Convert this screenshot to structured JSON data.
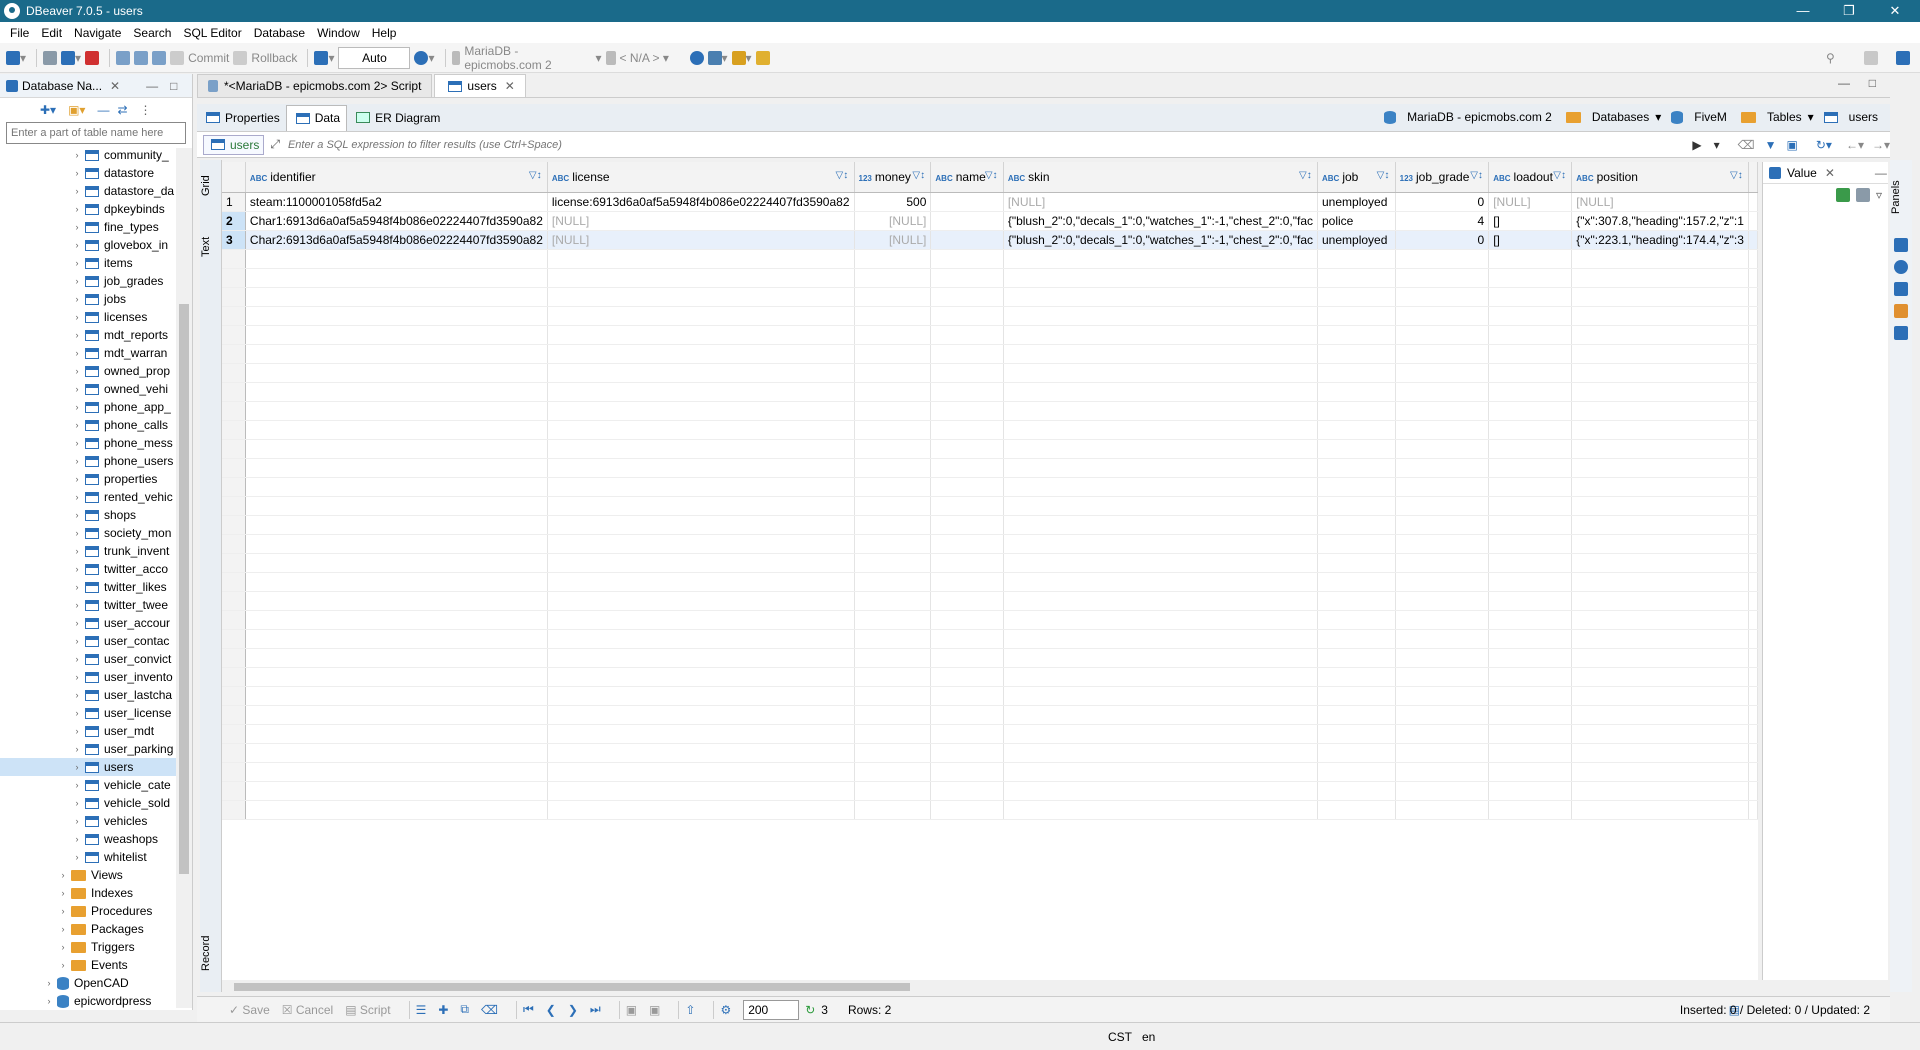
{
  "window": {
    "title": "DBeaver 7.0.5 - users"
  },
  "menu": [
    "File",
    "Edit",
    "Navigate",
    "Search",
    "SQL Editor",
    "Database",
    "Window",
    "Help"
  ],
  "toolbar": {
    "commit": "Commit",
    "rollback": "Rollback",
    "auto": "Auto",
    "connection": "MariaDB - epicmobs.com 2",
    "schema": "< N/A >"
  },
  "navigator": {
    "title": "Database Na...",
    "filter_placeholder": "Enter a part of table name here",
    "tables": [
      "community_",
      "datastore",
      "datastore_da",
      "dpkeybinds",
      "fine_types",
      "glovebox_in",
      "items",
      "job_grades",
      "jobs",
      "licenses",
      "mdt_reports",
      "mdt_warran",
      "owned_prop",
      "owned_vehi",
      "phone_app_",
      "phone_calls",
      "phone_mess",
      "phone_users",
      "properties",
      "rented_vehic",
      "shops",
      "society_mon",
      "trunk_invent",
      "twitter_acco",
      "twitter_likes",
      "twitter_twee",
      "user_accour",
      "user_contac",
      "user_convict",
      "user_invento",
      "user_lastcha",
      "user_license",
      "user_mdt",
      "user_parking",
      "users",
      "vehicle_cate",
      "vehicle_sold",
      "vehicles",
      "weashops",
      "whitelist"
    ],
    "selected": "users",
    "folders": [
      "Views",
      "Indexes",
      "Procedures",
      "Packages",
      "Triggers",
      "Events"
    ],
    "databases": [
      "OpenCAD",
      "epicwordpress"
    ]
  },
  "tabs": [
    {
      "label": "*<MariaDB - epicmobs.com 2> Script"
    },
    {
      "label": "users"
    }
  ],
  "subtabs": [
    "Properties",
    "Data",
    "ER Diagram"
  ],
  "breadcrumbs": [
    "MariaDB - epicmobs.com 2",
    "Databases",
    "FiveM",
    "Tables",
    "users"
  ],
  "filter": {
    "tag": "users",
    "placeholder": "Enter a SQL expression to filter results (use Ctrl+Space)"
  },
  "side_tabs": {
    "grid": "Grid",
    "text": "Text",
    "record": "Record"
  },
  "grid": {
    "columns": [
      {
        "type": "ABC",
        "name": "identifier"
      },
      {
        "type": "ABC",
        "name": "license"
      },
      {
        "type": "123",
        "name": "money"
      },
      {
        "type": "ABC",
        "name": "name"
      },
      {
        "type": "ABC",
        "name": "skin"
      },
      {
        "type": "ABC",
        "name": "job"
      },
      {
        "type": "123",
        "name": "job_grade"
      },
      {
        "type": "ABC",
        "name": "loadout"
      },
      {
        "type": "ABC",
        "name": "position"
      }
    ],
    "rows": [
      [
        "1",
        "steam:1100001058fd5a2",
        "license:6913d6a0af5a5948f4b086e02224407fd3590a82",
        "500",
        "",
        "[NULL]",
        "unemployed",
        "0",
        "[NULL]",
        "[NULL]"
      ],
      [
        "2",
        "Char1:6913d6a0af5a5948f4b086e02224407fd3590a82",
        "[NULL]",
        "[NULL]",
        "",
        "{\"blush_2\":0,\"decals_1\":0,\"watches_1\":-1,\"chest_2\":0,\"fac",
        "police",
        "4",
        "[]",
        "{\"x\":307.8,\"heading\":157.2,\"z\":1"
      ],
      [
        "3",
        "Char2:6913d6a0af5a5948f4b086e02224407fd3590a82",
        "[NULL]",
        "[NULL]",
        "",
        "{\"blush_2\":0,\"decals_1\":0,\"watches_1\":-1,\"chest_2\":0,\"fac",
        "unemployed",
        "0",
        "[]",
        "{\"x\":223.1,\"heading\":174.4,\"z\":3"
      ]
    ]
  },
  "value_panel": {
    "title": "Value"
  },
  "bottom": {
    "save": "Save",
    "cancel": "Cancel",
    "script": "Script",
    "fetch_size": "200",
    "refresh_count": "3",
    "rows": "Rows: 2",
    "stats": "Inserted: 0 / Deleted: 0 / Updated: 2"
  },
  "status": {
    "timezone": "CST",
    "locale": "en"
  },
  "colors": {
    "titlebar": "#1a6a8a",
    "accent": "#2c6fb7",
    "selection": "#cde3f7"
  }
}
